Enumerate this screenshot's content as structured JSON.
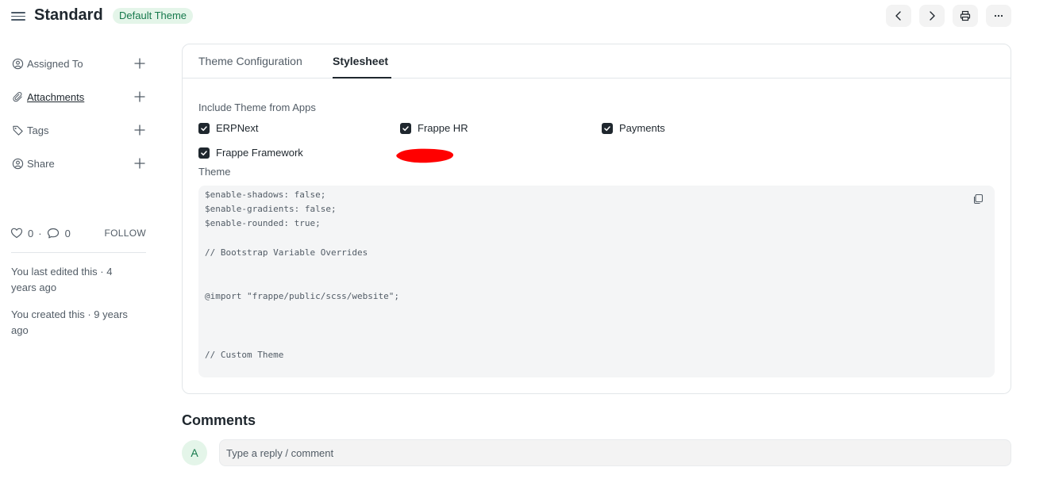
{
  "header": {
    "title": "Standard",
    "badge": "Default Theme"
  },
  "sidebar": {
    "items": [
      {
        "label": "Assigned To",
        "icon": "assign-user-icon"
      },
      {
        "label": "Attachments",
        "icon": "paperclip-icon"
      },
      {
        "label": "Tags",
        "icon": "tag-icon"
      },
      {
        "label": "Share",
        "icon": "share-user-icon"
      }
    ],
    "likes": "0",
    "comments": "0",
    "follow": "FOLLOW",
    "last_edited": "You last edited this · 4 years ago",
    "created": "You created this · 9 years ago"
  },
  "tabs": [
    {
      "label": "Theme Configuration",
      "active": false
    },
    {
      "label": "Stylesheet",
      "active": true
    }
  ],
  "stylesheet": {
    "include_label": "Include Theme from Apps",
    "apps": [
      {
        "label": "ERPNext",
        "checked": true
      },
      {
        "label": "Frappe HR",
        "checked": true
      },
      {
        "label": "Payments",
        "checked": true
      },
      {
        "label": "Frappe Framework",
        "checked": true
      }
    ],
    "theme_label": "Theme",
    "code_lines": [
      "$enable-shadows: false;",
      "$enable-gradients: false;",
      "$enable-rounded: true;",
      "// Bootstrap Variable Overrides",
      "@import \"frappe/public/scss/website\";",
      "// Custom Theme"
    ]
  },
  "comments": {
    "title": "Comments",
    "avatar_initial": "A",
    "placeholder": "Type a reply / comment"
  },
  "colors": {
    "badge_bg": "#e4f5e9",
    "badge_text": "#16794c",
    "redaction": "#ff0000"
  }
}
